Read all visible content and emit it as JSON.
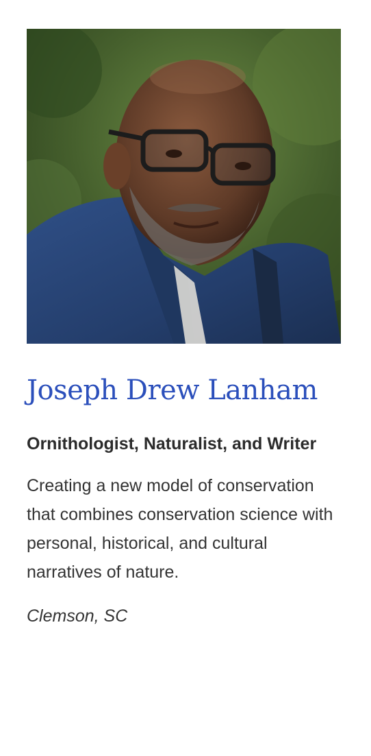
{
  "profile": {
    "name": "Joseph Drew Lanham",
    "title": "Ornithologist, Naturalist, and Writer",
    "description": "Creating a new model of conservation that combines conservation science with personal, historical, and cultural narratives of nature.",
    "location": "Clemson, SC"
  },
  "colors": {
    "name_link": "#2b4fbb",
    "title_text": "#2b2b2b",
    "body_text": "#333333",
    "background": "#ffffff"
  }
}
